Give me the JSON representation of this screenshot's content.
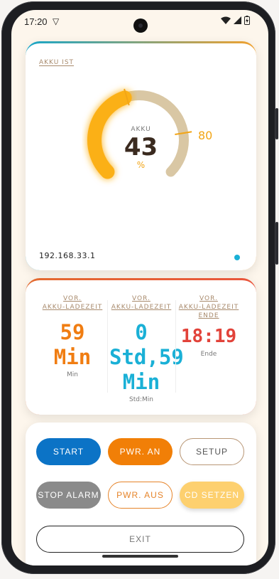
{
  "status_bar": {
    "time": "17:20"
  },
  "battery_card": {
    "section_label": "AKKU IST",
    "gauge_label": "AKKU",
    "value": "43",
    "unit": "%",
    "target": "80",
    "level_fraction": 0.43,
    "target_fraction": 0.8,
    "ip": "192.168.33.1"
  },
  "times_card": {
    "columns": [
      {
        "label_top": "VOR.",
        "label": "AKKU-LADEZEIT",
        "label_extra": "",
        "value": "59 Min",
        "sub": "Min",
        "color": "#f07d12"
      },
      {
        "label_top": "VOR.",
        "label": "AKKU-LADEZEIT",
        "label_extra": "",
        "value": "0 Std,59 Min",
        "sub": "Std:Min",
        "color": "#1ab0d6"
      },
      {
        "label_top": "VOR.",
        "label": "AKKU-LADEZEIT",
        "label_extra": "ENDE",
        "value": "18:19",
        "sub": "Ende",
        "color": "#e2433a"
      }
    ]
  },
  "buttons": {
    "start": "START",
    "pwr_an": "PWR. AN",
    "setup": "SETUP",
    "stop_alarm": "STOP ALARM",
    "pwr_aus": "PWR. AUS",
    "cd_setzen": "CD SETZEN",
    "exit": "EXIT"
  },
  "colors": {
    "accent_orange": "#f2a516",
    "track": "#d9c7a4",
    "start_blue": "#0b73c6",
    "pwr_orange": "#f17f07"
  }
}
